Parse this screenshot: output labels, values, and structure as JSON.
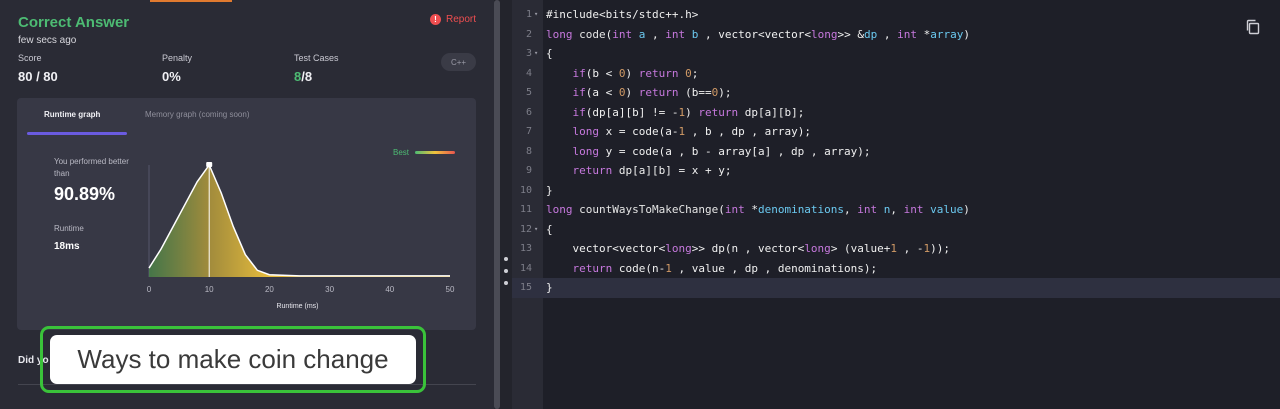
{
  "submission": {
    "status": "Correct Answer",
    "time_ago": "few secs ago",
    "report_label": "Report",
    "language": "C++",
    "score_label": "Score",
    "score_value": "80 / 80",
    "penalty_label": "Penalty",
    "penalty_value": "0%",
    "tests_label": "Test Cases",
    "tests_passed": "8",
    "tests_total": "/8"
  },
  "graph": {
    "tab_runtime": "Runtime graph",
    "tab_memory": "Memory graph (coming soon)",
    "perf_label": "You performed better than",
    "perf_value": "90.89%",
    "runtime_label": "Runtime",
    "runtime_value": "18ms",
    "legend_label": "Best"
  },
  "chart_data": {
    "type": "area",
    "xlabel": "Runtime (ms)",
    "xticks": [
      "0",
      "10",
      "20",
      "30",
      "40",
      "50"
    ],
    "xlim": [
      0,
      50
    ],
    "x": [
      0,
      2,
      4,
      6,
      8,
      10,
      12,
      14,
      16,
      18,
      20,
      25,
      30,
      40,
      50
    ],
    "y": [
      0.08,
      0.25,
      0.45,
      0.65,
      0.85,
      1.0,
      0.75,
      0.45,
      0.2,
      0.06,
      0.02,
      0.01,
      0.01,
      0.01,
      0.01
    ],
    "marker_x": 10,
    "colors": {
      "start": "#4a8a4a",
      "peak": "#f0c33c",
      "line": "#ffffff"
    }
  },
  "footer": {
    "did_you": "Did yo",
    "caption": "Ways to make coin change"
  },
  "code_lines": [
    {
      "n": "1",
      "fold": true,
      "html": "<span class=\"pp\">#include&lt;bits/stdc++.h&gt;</span>"
    },
    {
      "n": "2",
      "fold": false,
      "html": "<span class=\"kw\">long</span> <span class=\"fn\">code</span>(<span class=\"kw\">int</span> <span class=\"ty\">a</span> , <span class=\"kw\">int</span> <span class=\"ty\">b</span> , vector&lt;vector&lt;<span class=\"kw\">long</span>&gt;&gt; &amp;<span class=\"ty\">dp</span> , <span class=\"kw\">int</span> *<span class=\"ty\">array</span>)"
    },
    {
      "n": "3",
      "fold": true,
      "html": "{"
    },
    {
      "n": "4",
      "fold": false,
      "html": "    <span class=\"kw\">if</span>(b &lt; <span class=\"num\">0</span>) <span class=\"kw\">return</span> <span class=\"num\">0</span>;"
    },
    {
      "n": "5",
      "fold": false,
      "html": "    <span class=\"kw\">if</span>(a &lt; <span class=\"num\">0</span>) <span class=\"kw\">return</span> (b==<span class=\"num\">0</span>);"
    },
    {
      "n": "6",
      "fold": false,
      "html": "    <span class=\"kw\">if</span>(dp[a][b] != -<span class=\"num\">1</span>) <span class=\"kw\">return</span> dp[a][b];"
    },
    {
      "n": "7",
      "fold": false,
      "html": "    <span class=\"kw\">long</span> x = code(a-<span class=\"num\">1</span> , b , dp , array);"
    },
    {
      "n": "8",
      "fold": false,
      "html": "    <span class=\"kw\">long</span> y = code(a , b - array[a] , dp , array);"
    },
    {
      "n": "9",
      "fold": false,
      "html": "    <span class=\"kw\">return</span> dp[a][b] = x + y;"
    },
    {
      "n": "10",
      "fold": false,
      "html": "}"
    },
    {
      "n": "11",
      "fold": false,
      "html": "<span class=\"kw\">long</span> <span class=\"fn\">countWaysToMakeChange</span>(<span class=\"kw\">int</span> *<span class=\"ty\">denominations</span>, <span class=\"kw\">int</span> <span class=\"ty\">n</span>, <span class=\"kw\">int</span> <span class=\"ty\">value</span>)"
    },
    {
      "n": "12",
      "fold": true,
      "html": "{"
    },
    {
      "n": "13",
      "fold": false,
      "html": "    vector&lt;vector&lt;<span class=\"kw\">long</span>&gt;&gt; dp(n , vector&lt;<span class=\"kw\">long</span>&gt; (value+<span class=\"num\">1</span> , -<span class=\"num\">1</span>));"
    },
    {
      "n": "14",
      "fold": false,
      "html": "    <span class=\"kw\">return</span> code(n-<span class=\"num\">1</span> , value , dp , denominations);"
    },
    {
      "n": "15",
      "fold": false,
      "html": "}",
      "active": true
    }
  ]
}
